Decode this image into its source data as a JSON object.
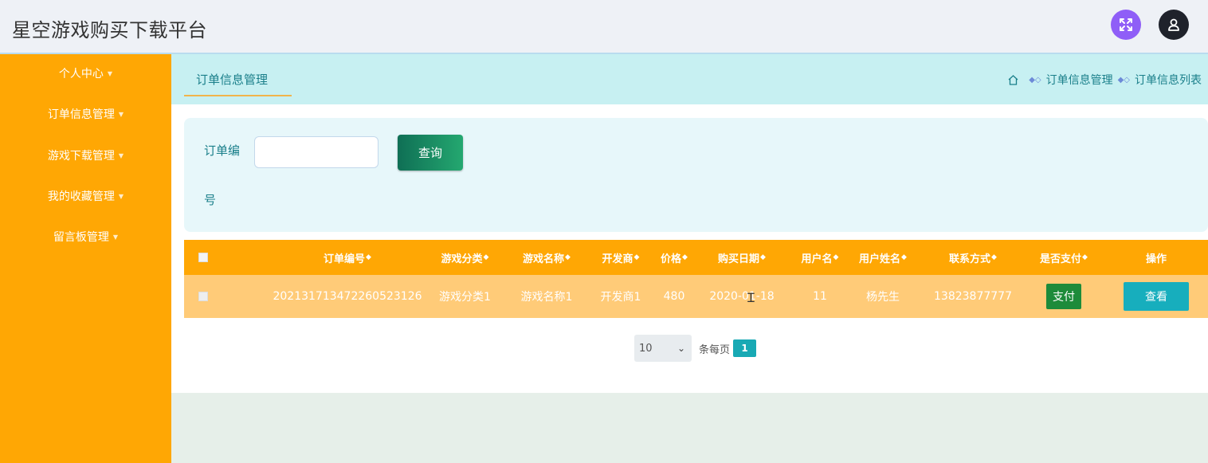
{
  "app": {
    "title": "星空游戏购买下载平台"
  },
  "header": {
    "fullscreen_icon": "expand-arrows-icon",
    "user_icon": "user-avatar-icon"
  },
  "sidebar": {
    "items": [
      {
        "label": "个人中心"
      },
      {
        "label": "订单信息管理"
      },
      {
        "label": "游戏下载管理"
      },
      {
        "label": "我的收藏管理"
      },
      {
        "label": "留言板管理"
      }
    ]
  },
  "tabs": {
    "active": "订单信息管理"
  },
  "breadcrumb": {
    "level1": "订单信息管理",
    "level2": "订单信息列表"
  },
  "search": {
    "label_part1": "订单编",
    "label_part2": "号",
    "value": "",
    "placeholder": "",
    "button": "查询"
  },
  "table": {
    "headers": [
      "订单编号",
      "游戏分类",
      "游戏名称",
      "开发商",
      "价格",
      "购买日期",
      "用户名",
      "用户姓名",
      "联系方式",
      "是否支付",
      "操作"
    ],
    "rows": [
      {
        "order_no": "20213171347226052312​6",
        "category": "游戏分类1",
        "game_name": "游戏名称1",
        "developer": "开发商1",
        "price": "480",
        "date": "2020-01-18",
        "username": "11",
        "real_name": "杨先生",
        "phone": "13823877777",
        "pay_button": "支付",
        "view_button": "查看"
      }
    ]
  },
  "pagination": {
    "page_size": "10",
    "per_page_label": "条每页",
    "current_page": "1"
  },
  "colors": {
    "sidebar": "#ffa704",
    "header_row": "#ffa704",
    "data_row": "#ffcb78",
    "tabbar": "#c7f0f2",
    "accent": "#17aebd"
  }
}
